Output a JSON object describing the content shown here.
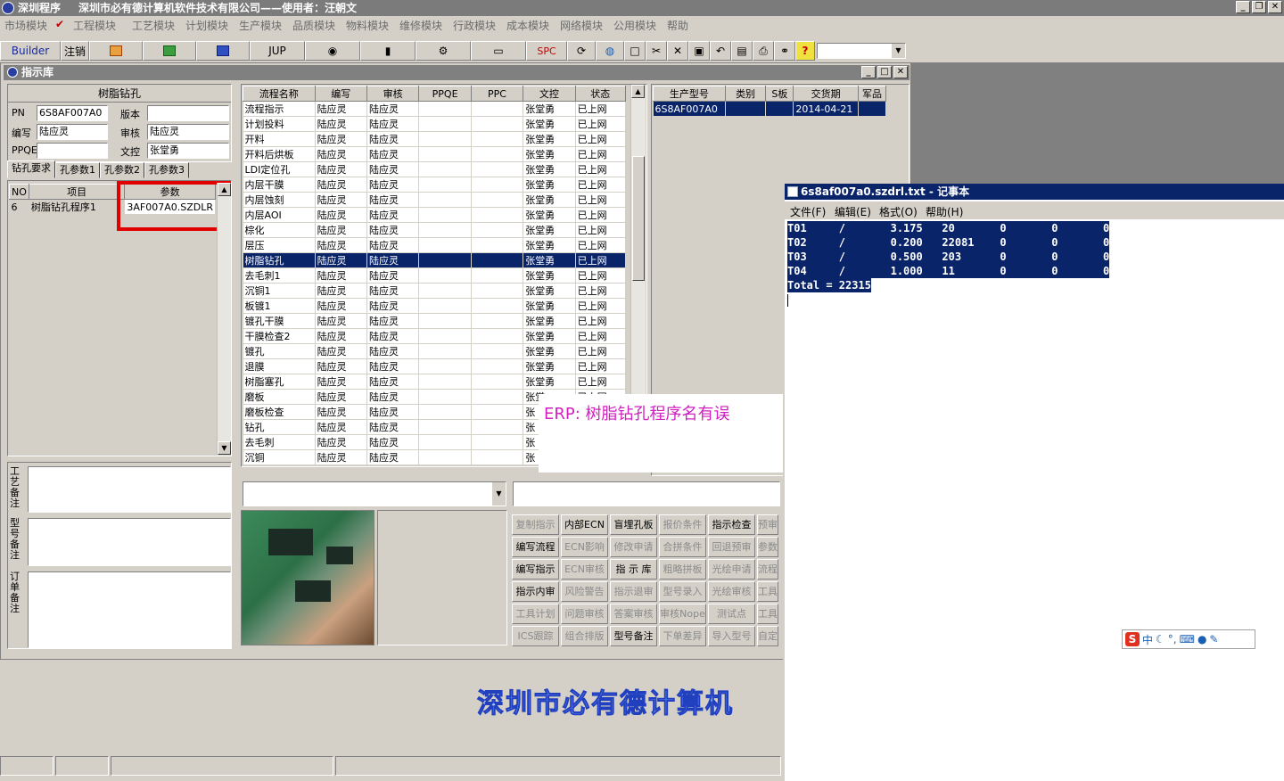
{
  "app": {
    "title": "深圳程序",
    "company": "深圳市必有德计算机软件技术有限公司——使用者：汪朝文"
  },
  "menu": [
    "市场模块",
    "工程模块",
    "工艺模块",
    "计划模块",
    "生产模块",
    "品质模块",
    "物料模块",
    "维修模块",
    "行政模块",
    "成本模块",
    "网络模块",
    "公用模块",
    "帮助"
  ],
  "toolbar": {
    "builder": "Builder",
    "logout": "注销",
    "jup": "JUP",
    "spc": "SPC"
  },
  "subwindow": {
    "title": "指示库"
  },
  "info": {
    "heading": "树脂钻孔",
    "pn_label": "PN",
    "pn": "6S8AF007A0",
    "version_label": "版本",
    "version": "",
    "writer_label": "编写",
    "writer": "陆应灵",
    "reviewer_label": "审核",
    "reviewer": "陆应灵",
    "ppqe_label": "PPQE",
    "ppqe": "",
    "doc_label": "文控",
    "doc": "张堂勇"
  },
  "tabs": [
    "钻孔要求",
    "孔参数1",
    "孔参数2",
    "孔参数3"
  ],
  "param_table": {
    "headers": [
      "NO",
      "项目",
      "参数"
    ],
    "rows": [
      [
        "6",
        "树脂钻孔程序1",
        "3AF007A0.SZDLR"
      ]
    ]
  },
  "notes": [
    "工艺备注",
    "型号备注",
    "订单备注"
  ],
  "flow_table": {
    "headers": [
      "流程名称",
      "编写",
      "审核",
      "PPQE",
      "PPC",
      "文控",
      "状态"
    ],
    "rows": [
      [
        "流程指示",
        "陆应灵",
        "陆应灵",
        "",
        "",
        "张堂勇",
        "已上网"
      ],
      [
        "计划投料",
        "陆应灵",
        "陆应灵",
        "",
        "",
        "张堂勇",
        "已上网"
      ],
      [
        "开料",
        "陆应灵",
        "陆应灵",
        "",
        "",
        "张堂勇",
        "已上网"
      ],
      [
        "开料后烘板",
        "陆应灵",
        "陆应灵",
        "",
        "",
        "张堂勇",
        "已上网"
      ],
      [
        "LDI定位孔",
        "陆应灵",
        "陆应灵",
        "",
        "",
        "张堂勇",
        "已上网"
      ],
      [
        "内层干膜",
        "陆应灵",
        "陆应灵",
        "",
        "",
        "张堂勇",
        "已上网"
      ],
      [
        "内层蚀刻",
        "陆应灵",
        "陆应灵",
        "",
        "",
        "张堂勇",
        "已上网"
      ],
      [
        "内层AOI",
        "陆应灵",
        "陆应灵",
        "",
        "",
        "张堂勇",
        "已上网"
      ],
      [
        "棕化",
        "陆应灵",
        "陆应灵",
        "",
        "",
        "张堂勇",
        "已上网"
      ],
      [
        "层压",
        "陆应灵",
        "陆应灵",
        "",
        "",
        "张堂勇",
        "已上网"
      ],
      [
        "树脂钻孔",
        "陆应灵",
        "陆应灵",
        "",
        "",
        "张堂勇",
        "已上网"
      ],
      [
        "去毛刺1",
        "陆应灵",
        "陆应灵",
        "",
        "",
        "张堂勇",
        "已上网"
      ],
      [
        "沉铜1",
        "陆应灵",
        "陆应灵",
        "",
        "",
        "张堂勇",
        "已上网"
      ],
      [
        "板镀1",
        "陆应灵",
        "陆应灵",
        "",
        "",
        "张堂勇",
        "已上网"
      ],
      [
        "镀孔干膜",
        "陆应灵",
        "陆应灵",
        "",
        "",
        "张堂勇",
        "已上网"
      ],
      [
        "干膜检查2",
        "陆应灵",
        "陆应灵",
        "",
        "",
        "张堂勇",
        "已上网"
      ],
      [
        "镀孔",
        "陆应灵",
        "陆应灵",
        "",
        "",
        "张堂勇",
        "已上网"
      ],
      [
        "退膜",
        "陆应灵",
        "陆应灵",
        "",
        "",
        "张堂勇",
        "已上网"
      ],
      [
        "树脂塞孔",
        "陆应灵",
        "陆应灵",
        "",
        "",
        "张堂勇",
        "已上网"
      ],
      [
        "磨板",
        "陆应灵",
        "陆应灵",
        "",
        "",
        "张堂",
        "已上网"
      ],
      [
        "磨板检查",
        "陆应灵",
        "陆应灵",
        "",
        "",
        "张",
        "已上网"
      ],
      [
        "钻孔",
        "陆应灵",
        "陆应灵",
        "",
        "",
        "张",
        "已上网"
      ],
      [
        "去毛刺",
        "陆应灵",
        "陆应灵",
        "",
        "",
        "张",
        "已上网"
      ],
      [
        "沉铜",
        "陆应灵",
        "陆应灵",
        "",
        "",
        "张",
        "已上网"
      ]
    ],
    "selected": 10
  },
  "model_table": {
    "headers": [
      "生产型号",
      "类别",
      "S板",
      "交货期",
      "军品"
    ],
    "rows": [
      [
        "6S8AF007A0",
        "",
        "",
        "2014-04-21",
        ""
      ]
    ]
  },
  "buttons": [
    [
      "复制指示",
      "内部ECN",
      "盲埋孔板",
      "报价条件",
      "指示检查",
      "预审"
    ],
    [
      "编写流程",
      "ECN影响",
      "修改申请",
      "合拼条件",
      "回退预审",
      "参数"
    ],
    [
      "编写指示",
      "ECN审核",
      "指 示 库",
      "粗略拼板",
      "光绘申请",
      "流程"
    ],
    [
      "指示内审",
      "风险警告",
      "指示退审",
      "型号录入",
      "光绘审核",
      "工具"
    ],
    [
      "工具计划",
      "问题审核",
      "答案审核",
      "审核Nope",
      "测试点",
      "工具"
    ],
    [
      "ICS跟踪",
      "组合排版",
      "型号备注",
      "下单差异",
      "导入型号",
      "自定"
    ]
  ],
  "active_buttons": [
    "内部ECN",
    "盲埋孔板",
    "指示检查",
    "编写流程",
    "编写指示",
    "指 示 库",
    "指示内审",
    "型号备注"
  ],
  "notepad": {
    "title": "6s8af007a0.szdrl.txt - 记事本",
    "menu": [
      "文件(F)",
      "编辑(E)",
      "格式(O)",
      "帮助(H)"
    ],
    "lines": [
      "T01     /       3.175   20       0       0       0",
      "T02     /       0.200   22081    0       0       0",
      "T03     /       0.500   203      0       0       0",
      "T04     /       1.000   11       0       0       0",
      "Total = 22315"
    ]
  },
  "annotation": "ERP: 树脂钻孔程序名有误",
  "banner": "深圳市必有德计算机",
  "ime": {
    "label": "中"
  },
  "colors": {
    "selection": "#0a246a",
    "annotation": "#d020c0",
    "highlight_box": "#e00000"
  }
}
